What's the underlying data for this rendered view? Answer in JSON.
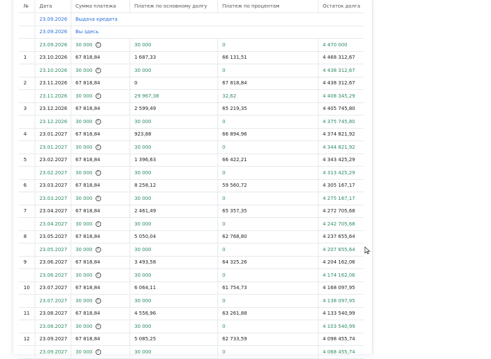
{
  "table": {
    "headers": [
      "№",
      "Дата",
      "Сумма платежа",
      "Платеж по основному долгу",
      "Платеж по процентам",
      "Остаток долга"
    ],
    "info_rows": [
      {
        "date": "23.09.2026",
        "text": "Выдача кредита"
      },
      {
        "date": "23.09.2026",
        "text": "Вы здесь"
      }
    ],
    "rows": [
      {
        "kind": "sub",
        "num": "",
        "date": "23.09.2026",
        "amount": "30 000",
        "principal": "30 000",
        "interest": "0",
        "balance": "4 470 000"
      },
      {
        "kind": "main",
        "num": "1",
        "date": "23.10.2026",
        "amount": "67 818,84",
        "principal": "1 687,33",
        "interest": "66 131,51",
        "balance": "4 468 312,67"
      },
      {
        "kind": "sub",
        "num": "",
        "date": "23.10.2026",
        "amount": "30 000",
        "principal": "30 000",
        "interest": "0",
        "balance": "4 438 312,67"
      },
      {
        "kind": "main",
        "num": "2",
        "date": "23.11.2026",
        "amount": "67 818,84",
        "principal": "0",
        "interest": "67 818,84",
        "balance": "4 438 312,67"
      },
      {
        "kind": "sub",
        "num": "",
        "date": "23.11.2026",
        "amount": "30 000",
        "principal": "29 967,38",
        "interest": "32,62",
        "balance": "4 408 345,29"
      },
      {
        "kind": "main",
        "num": "3",
        "date": "23.12.2026",
        "amount": "67 818,84",
        "principal": "2 599,49",
        "interest": "65 219,35",
        "balance": "4 405 745,80"
      },
      {
        "kind": "sub",
        "num": "",
        "date": "23.12.2026",
        "amount": "30 000",
        "principal": "30 000",
        "interest": "0",
        "balance": "4 375 745,80"
      },
      {
        "kind": "main",
        "num": "4",
        "date": "23.01.2027",
        "amount": "67 818,84",
        "principal": "923,88",
        "interest": "66 894,96",
        "balance": "4 374 821,92"
      },
      {
        "kind": "sub",
        "num": "",
        "date": "23.01.2027",
        "amount": "30 000",
        "principal": "30 000",
        "interest": "0",
        "balance": "4 344 821,92"
      },
      {
        "kind": "main",
        "num": "5",
        "date": "23.02.2027",
        "amount": "67 818,84",
        "principal": "1 396,63",
        "interest": "66 422,21",
        "balance": "4 343 425,29"
      },
      {
        "kind": "sub",
        "num": "",
        "date": "23.02.2027",
        "amount": "30 000",
        "principal": "30 000",
        "interest": "0",
        "balance": "4 313 425,29"
      },
      {
        "kind": "main",
        "num": "6",
        "date": "23.03.2027",
        "amount": "67 818,84",
        "principal": "8 258,12",
        "interest": "59 560,72",
        "balance": "4 305 167,17"
      },
      {
        "kind": "sub",
        "num": "",
        "date": "23.03.2027",
        "amount": "30 000",
        "principal": "30 000",
        "interest": "0",
        "balance": "4 275 167,17"
      },
      {
        "kind": "main",
        "num": "7",
        "date": "23.04.2027",
        "amount": "67 818,84",
        "principal": "2 461,49",
        "interest": "65 357,35",
        "balance": "4 272 705,68"
      },
      {
        "kind": "sub",
        "num": "",
        "date": "23.04.2027",
        "amount": "30 000",
        "principal": "30 000",
        "interest": "0",
        "balance": "4 242 705,68"
      },
      {
        "kind": "main",
        "num": "8",
        "date": "23.05.2027",
        "amount": "67 818,84",
        "principal": "5 050,04",
        "interest": "62 768,80",
        "balance": "4 237 655,64"
      },
      {
        "kind": "sub",
        "num": "",
        "date": "23.05.2027",
        "amount": "30 000",
        "principal": "30 000",
        "interest": "0",
        "balance": "4 207 655,64"
      },
      {
        "kind": "main",
        "num": "9",
        "date": "23.06.2027",
        "amount": "67 818,84",
        "principal": "3 493,58",
        "interest": "64 325,26",
        "balance": "4 204 162,06"
      },
      {
        "kind": "sub",
        "num": "",
        "date": "23.06.2027",
        "amount": "30 000",
        "principal": "30 000",
        "interest": "0",
        "balance": "4 174 162,06"
      },
      {
        "kind": "main",
        "num": "10",
        "date": "23.07.2027",
        "amount": "67 818,84",
        "principal": "6 064,11",
        "interest": "61 754,73",
        "balance": "4 168 097,95"
      },
      {
        "kind": "sub",
        "num": "",
        "date": "23.07.2027",
        "amount": "30 000",
        "principal": "30 000",
        "interest": "0",
        "balance": "4 138 097,95"
      },
      {
        "kind": "main",
        "num": "11",
        "date": "23.08.2027",
        "amount": "67 818,84",
        "principal": "4 556,96",
        "interest": "63 261,88",
        "balance": "4 133 540,99"
      },
      {
        "kind": "sub",
        "num": "",
        "date": "23.08.2027",
        "amount": "30 000",
        "principal": "30 000",
        "interest": "0",
        "balance": "4 103 540,99"
      },
      {
        "kind": "main",
        "num": "12",
        "date": "23.09.2027",
        "amount": "67 818,84",
        "principal": "5 085,25",
        "interest": "62 733,59",
        "balance": "4 098 455,74"
      },
      {
        "kind": "sub",
        "num": "",
        "date": "23.09.2027",
        "amount": "30 000",
        "principal": "30 000",
        "interest": "0",
        "balance": "4 068 455,74"
      }
    ],
    "info_icon_glyph": "!",
    "icons": {
      "info": "info-circle-icon",
      "cursor": "mouse-pointer-icon"
    },
    "colors": {
      "sub_row_text": "#2c8a63",
      "info_row_text": "#2a6fd6"
    }
  }
}
